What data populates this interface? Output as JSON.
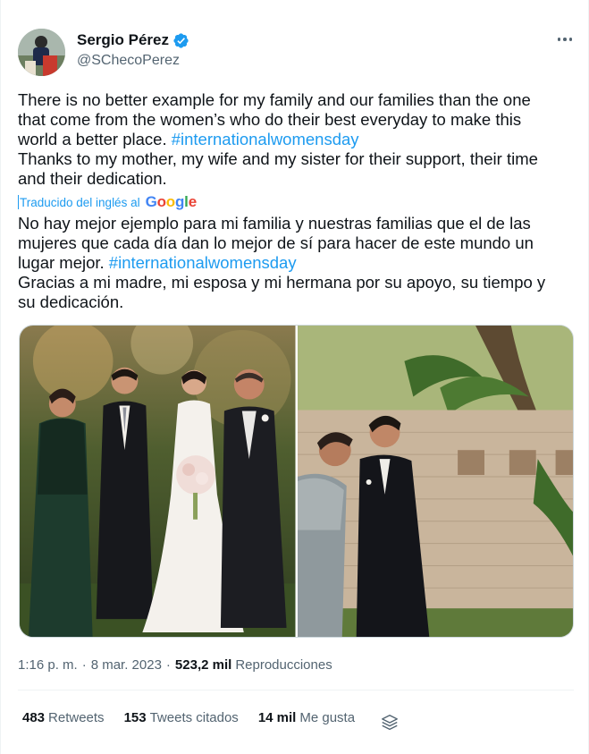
{
  "author": {
    "display_name": "Sergio Pérez",
    "handle": "@SChecoPerez",
    "verified": true
  },
  "tweet": {
    "original_lines": [
      "There is no better example for my family and our families than the one",
      "that come from the women’s who do their best everyday to make this",
      "world a better place.",
      "Thanks to my mother, my wife and my sister for their support, their time",
      "and their dedication."
    ],
    "hashtag": "#internationalwomensday",
    "translation_label": "Traducido del inglés al",
    "translation_provider": "Google",
    "translated_lines": [
      "No hay mejor ejemplo para mi familia y nuestras familias que el de las",
      "mujeres que cada día dan lo mejor de sí para hacer de este mundo un",
      "lugar mejor.",
      "Gracias a mi madre, mi esposa y mi hermana por su apoyo, su tiempo y",
      "su dedicación."
    ]
  },
  "meta": {
    "time": "1:16 p. m.",
    "separator": "·",
    "date": "8 mar. 2023",
    "views_count": "523,2 mil",
    "views_label": "Reproducciones"
  },
  "stats": {
    "retweets_count": "483",
    "retweets_label": "Retweets",
    "quotes_count": "153",
    "quotes_label": "Tweets citados",
    "likes_count": "14 mil",
    "likes_label": "Me gusta"
  },
  "icons": {
    "verified": "verified-badge-icon",
    "more": "more-options-icon",
    "layers": "layers-icon"
  },
  "colors": {
    "link": "#1d9bf0",
    "text": "#0f1419",
    "secondary": "#536471",
    "border": "#eff3f4",
    "google_blue": "#4285f4",
    "google_red": "#ea4335",
    "google_yellow": "#fbbc05",
    "google_green": "#34a853"
  }
}
